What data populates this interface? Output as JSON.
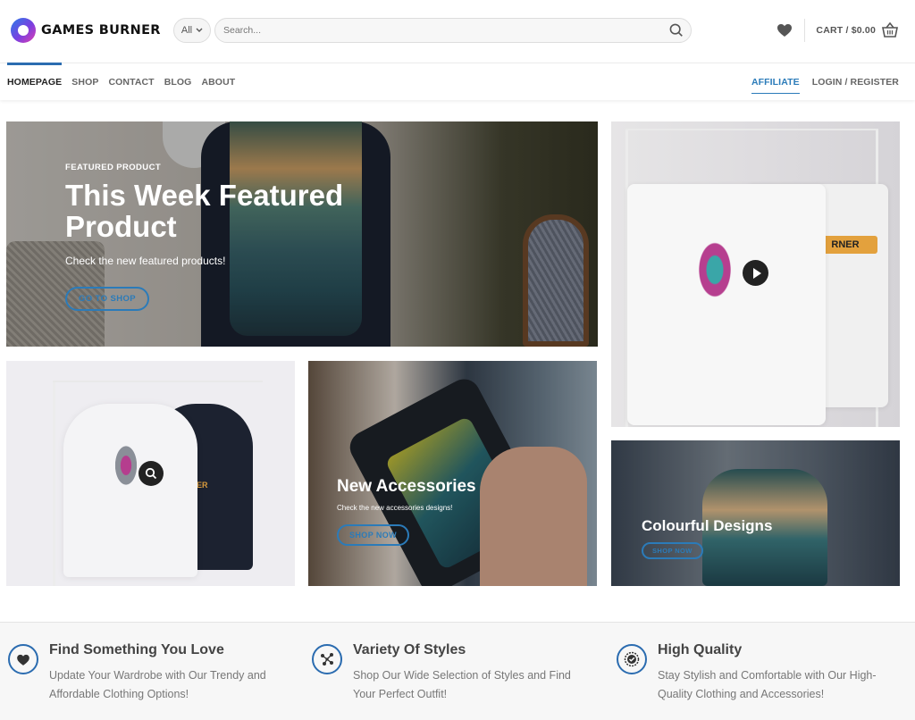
{
  "header": {
    "brand": "GAMES BURNER",
    "search": {
      "category": "All",
      "placeholder": "Search..."
    },
    "cart_label": "CART / $0.00"
  },
  "nav": {
    "left": [
      "HOMEPAGE",
      "SHOP",
      "CONTACT",
      "BLOG",
      "ABOUT"
    ],
    "right": [
      "AFFILIATE",
      "LOGIN / REGISTER"
    ],
    "active": "HOMEPAGE"
  },
  "featured": {
    "kicker": "FEATURED PRODUCT",
    "title": "This Week Featured Product",
    "subtitle": "Check the new featured products!",
    "button": "GO TO SHOP"
  },
  "accessories": {
    "title": "New Accessories",
    "subtitle": "Check the new accessories designs!",
    "button": "SHOP NOW"
  },
  "designs": {
    "title": "Colourful Designs",
    "button": "SHOP NOW"
  },
  "tshirt_brand": "RNER",
  "hoodie_brand": "RNER",
  "features": [
    {
      "icon": "heart-icon",
      "title": "Find Something You Love",
      "desc": "Update Your Wardrobe with Our Trendy and Affordable Clothing Options!"
    },
    {
      "icon": "nodes-icon",
      "title": "Variety Of Styles",
      "desc": "Shop Our Wide Selection of Styles and Find Your Perfect Outfit!"
    },
    {
      "icon": "badge-icon",
      "title": "High Quality",
      "desc": "Stay Stylish and Comfortable with Our High-Quality Clothing and Accessories!"
    }
  ],
  "colors": {
    "accent": "#2b6cb0",
    "link": "#2b7bb9"
  }
}
